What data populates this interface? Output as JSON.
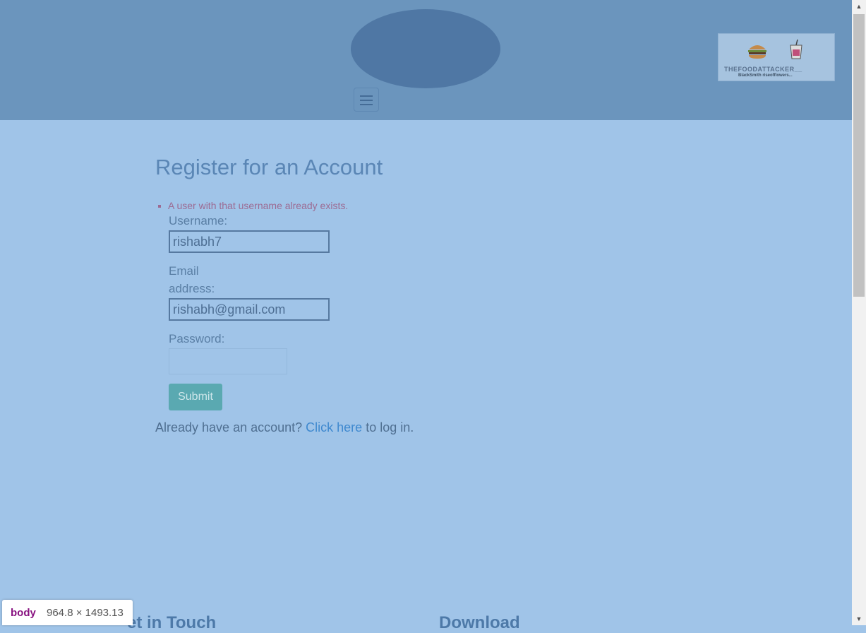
{
  "header": {
    "logo_title": "THEFOODATTACKER__",
    "logo_subtitle": "BlackSmith riseofflowers...",
    "menu_icon": "hamburger-menu-icon"
  },
  "form": {
    "title": "Register for an Account",
    "errors": [
      "A user with that username already exists."
    ],
    "username_label": "Username:",
    "username_value": "rishabh7",
    "email_label_line1": "Email",
    "email_label_line2": "address:",
    "email_value": "rishabh@gmail.com",
    "password_label": "Password:",
    "password_value": "",
    "submit_label": "Submit"
  },
  "login_prompt": {
    "before": "Already have an account? ",
    "link": "Click here",
    "after": " to log in."
  },
  "footer": {
    "col1_heading": "et in Touch",
    "col2_heading": "Download"
  },
  "devtools_tooltip": {
    "tag": "body",
    "dimensions": "964.8 × 1493.13"
  },
  "colors": {
    "page_bg": "#a0c4e8",
    "header_bg": "#6b95bd",
    "submit_bg": "#5aa9b1",
    "link": "#3f89cf",
    "error": "#9c6b93"
  }
}
